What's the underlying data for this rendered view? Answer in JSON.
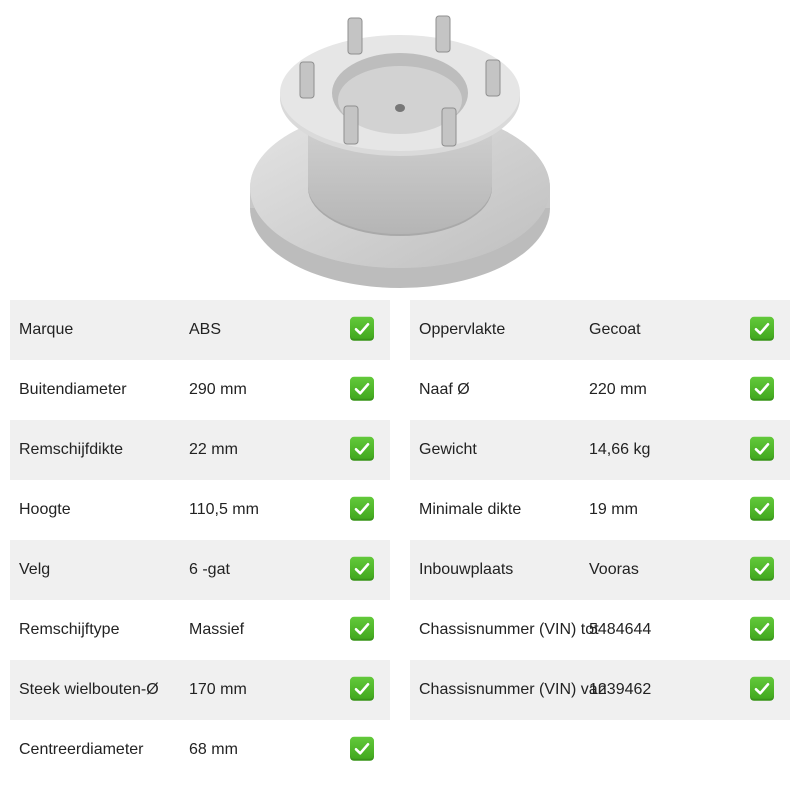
{
  "product": {
    "image_icon": "brake-disc-image"
  },
  "check_icon": "check-mark-icon",
  "colors": {
    "check": "#4cb82a",
    "row_shade": "#f0f0f0"
  },
  "specs_left": [
    {
      "label": "Marque",
      "value": "ABS"
    },
    {
      "label": "Buitendiameter",
      "value": "290 mm"
    },
    {
      "label": "Remschijfdikte",
      "value": "22 mm"
    },
    {
      "label": "Hoogte",
      "value": "110,5 mm"
    },
    {
      "label": "Velg",
      "value": "6 -gat"
    },
    {
      "label": "Remschijftype",
      "value": "Massief"
    },
    {
      "label": "Steek wielbouten-Ø",
      "value": "170 mm"
    },
    {
      "label": "Centreerdiameter",
      "value": "68 mm"
    }
  ],
  "specs_right": [
    {
      "label": "Oppervlakte",
      "value": "Gecoat"
    },
    {
      "label": "Naaf Ø",
      "value": "220 mm"
    },
    {
      "label": "Gewicht",
      "value": "14,66 kg"
    },
    {
      "label": "Minimale dikte",
      "value": "19 mm"
    },
    {
      "label": "Inbouwplaats",
      "value": "Vooras"
    },
    {
      "label": "Chassisnummer (VIN) tot",
      "value": "5484644"
    },
    {
      "label": "Chassisnummer (VIN) van",
      "value": "1239462"
    }
  ]
}
